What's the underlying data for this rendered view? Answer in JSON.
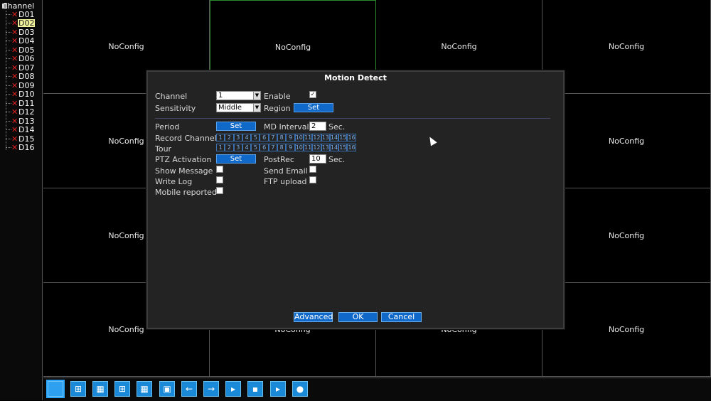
{
  "sidebar": {
    "root_label": "Channel",
    "channels": [
      "D01",
      "D02",
      "D03",
      "D04",
      "D05",
      "D06",
      "D07",
      "D08",
      "D09",
      "D10",
      "D11",
      "D12",
      "D13",
      "D14",
      "D15",
      "D16"
    ],
    "selected_channel": "D02"
  },
  "grid": {
    "cell_label": "NoConfig",
    "rows": 4,
    "cols": 4
  },
  "dialog": {
    "title": "Motion Detect",
    "channel_label": "Channel",
    "channel_value": "1",
    "enable_label": "Enable",
    "enable_checked": true,
    "sensitivity_label": "Sensitivity",
    "sensitivity_value": "Middle",
    "region_label": "Region",
    "set_label": "Set",
    "period_label": "Period",
    "md_interval_label": "MD Interval",
    "md_interval_value": "2",
    "sec_label": "Sec.",
    "record_channel_label": "Record Channel",
    "tour_label": "Tour",
    "channel_numbers": [
      "1",
      "2",
      "3",
      "4",
      "5",
      "6",
      "7",
      "8",
      "9",
      "10",
      "11",
      "12",
      "13",
      "14",
      "15",
      "16"
    ],
    "ptz_activation_label": "PTZ Activation",
    "postrec_label": "PostRec",
    "postrec_value": "10",
    "show_message_label": "Show Message",
    "send_email_label": "Send Email",
    "write_log_label": "Write Log",
    "ftp_upload_label": "FTP upload",
    "mobile_reported_label": "Mobile reported",
    "advanced_label": "Advanced",
    "ok_label": "OK",
    "cancel_label": "Cancel"
  },
  "toolbar": {
    "icons": [
      "single-view-icon",
      "quad-view-icon",
      "eight-view-icon",
      "nine-view-icon",
      "sixteen-view-icon",
      "fullscreen-icon",
      "previous-arrow-icon",
      "next-arrow-icon",
      "play-icon",
      "record-icon",
      "playback-icon",
      "snapshot-icon"
    ]
  },
  "colors": {
    "accent_blue": "#1068c8",
    "selected_channel_bg": "#f2f29a",
    "error_x": "#e02020",
    "active_cell_border": "#2a8a2a"
  }
}
